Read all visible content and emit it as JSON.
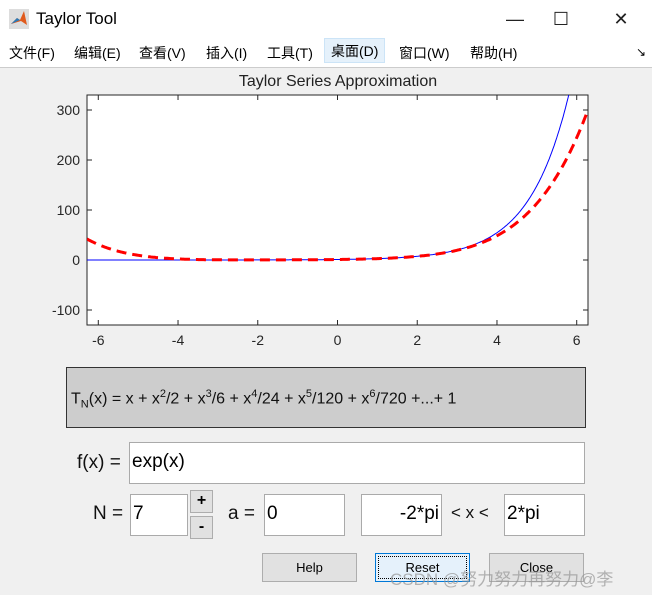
{
  "window": {
    "title": "Taylor Tool",
    "minimize": "—",
    "maximize": "☐",
    "close": "✕"
  },
  "menu": [
    "文件(F)",
    "编辑(E)",
    "查看(V)",
    "插入(I)",
    "工具(T)",
    "桌面(D)",
    "窗口(W)",
    "帮助(H)"
  ],
  "chart_data": {
    "type": "line",
    "title": "Taylor Series Approximation",
    "xlim": [
      -6.2832,
      6.2832
    ],
    "ylim": [
      -130,
      330
    ],
    "xticks": [
      -6,
      -4,
      -2,
      0,
      2,
      4,
      6
    ],
    "yticks": [
      -100,
      0,
      100,
      200,
      300
    ],
    "series": [
      {
        "function": "exp(x)",
        "color": "#0000ff",
        "style": "solid"
      },
      {
        "function": "Taylor polynomial N=7 at a=0",
        "color": "#ff0000",
        "style": "dashed"
      }
    ]
  },
  "formula": {
    "lhs": "T",
    "sub": "N",
    "rest": "(x) = x + x",
    "t": [
      [
        "2",
        "/2 + x"
      ],
      [
        "3",
        "/6 + x"
      ],
      [
        "4",
        "/24 + x"
      ],
      [
        "5",
        "/120 + x"
      ],
      [
        "6",
        "/720 +...+ 1"
      ]
    ]
  },
  "controls": {
    "fx_label": "f(x) =",
    "fx_value": "exp(x)",
    "n_label": "N =",
    "n_value": "7",
    "plus": "+",
    "minus": "-",
    "a_label": "a =",
    "a_value": "0",
    "xmin": "-2*pi",
    "x_label": "< x <",
    "xmax": "2*pi"
  },
  "buttons": {
    "help": "Help",
    "reset": "Reset",
    "close": "Close"
  },
  "watermark": "CSDN @努力努力再努力@李"
}
